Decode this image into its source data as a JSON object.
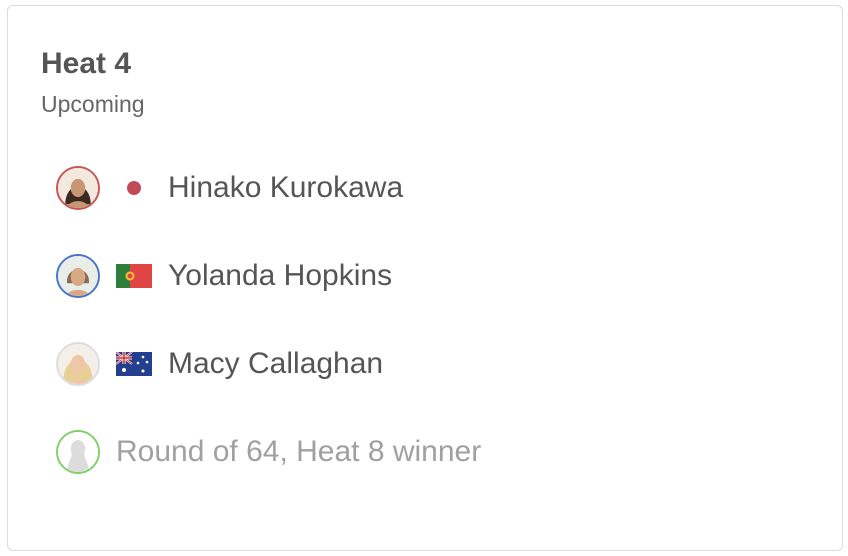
{
  "heat": {
    "title": "Heat 4",
    "status": "Upcoming"
  },
  "competitors": [
    {
      "name": "Hinako Kurokawa",
      "flag": "japan-flag",
      "ring_color": "#c65757"
    },
    {
      "name": "Yolanda Hopkins",
      "flag": "portugal-flag",
      "ring_color": "#4a74c9"
    },
    {
      "name": "Macy Callaghan",
      "flag": "australia-flag",
      "ring_color": "#dddddd"
    },
    {
      "name": "Round of 64, Heat 8 winner",
      "flag": "",
      "ring_color": "#7fcf6a"
    }
  ]
}
